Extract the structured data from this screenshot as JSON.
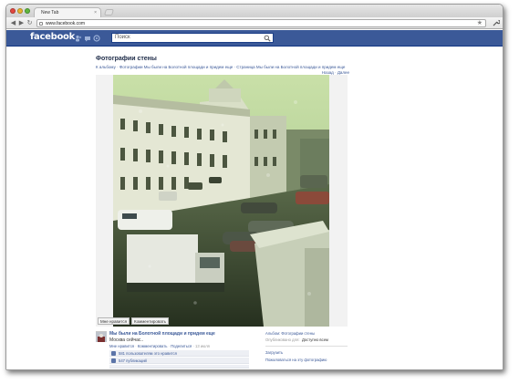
{
  "browser": {
    "tab_title": "New Tab",
    "tab_close": "×",
    "url": "www.facebook.com",
    "star_icon": "★",
    "wrench_icon": "🔧",
    "back_icon": "◀",
    "forward_icon": "▶",
    "reload_icon": "↻"
  },
  "facebook": {
    "logo": "facebook",
    "search_placeholder": "Поиск",
    "brand_color": "#3b5998"
  },
  "photo_page": {
    "title": "Фотографии стены",
    "breadcrumb": {
      "album_link": "К альбому",
      "album_name": "Фотографии Мы были на Болотной площади и придем еще",
      "separator": " · ",
      "page_link": "Страница Мы были на Болотной площади и придем еще",
      "prev": "Назад",
      "next": "Далее"
    },
    "photo_alt_icon": "photo-flooded-street",
    "actions": {
      "like": "Мне нравится",
      "comment": "Комментировать"
    },
    "post": {
      "author": "Мы были на Болотной площади и придем еще",
      "text": "Москва сейчас..",
      "meta_like": "Мне нравится",
      "meta_comment": "Комментировать",
      "meta_share": "Поделиться",
      "meta_time": "13 июля",
      "likes": "581 пользователям это нравится",
      "shares": "547 публикаций"
    },
    "side": {
      "album_label": "Альбом:",
      "album_value": "Фотографии стены",
      "published_label": "Опубликовано для:",
      "published_value": "Доступно всем",
      "download": "Загрузить",
      "report": "Пожаловаться на эту фотографию"
    }
  }
}
